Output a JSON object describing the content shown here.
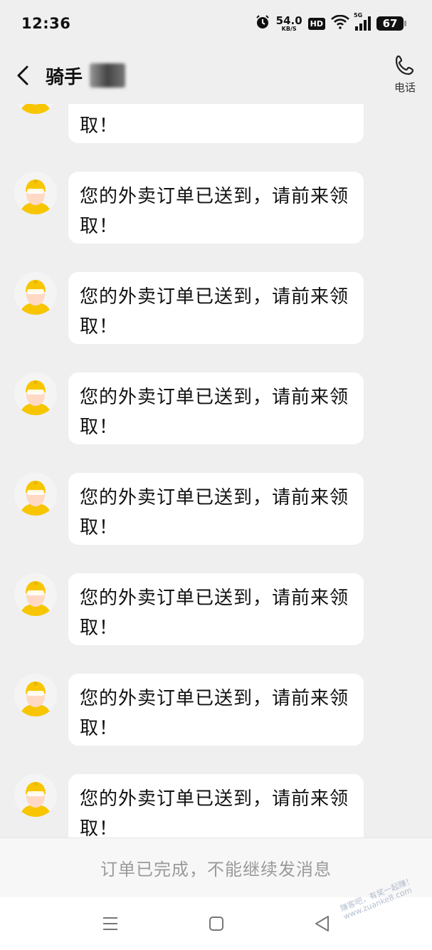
{
  "status_bar": {
    "time": "12:36",
    "net_speed": "54.0",
    "net_unit": "KB/S",
    "hd": "HD",
    "network": "5G",
    "battery": "67"
  },
  "header": {
    "title": "骑手",
    "call_label": "电话"
  },
  "messages": [
    {
      "text": "您的外卖订单已送到，请前来领取！"
    },
    {
      "text": "您的外卖订单已送到，请前来领取！"
    },
    {
      "text": "您的外卖订单已送到，请前来领取！"
    },
    {
      "text": "您的外卖订单已送到，请前来领取！"
    },
    {
      "text": "您的外卖订单已送到，请前来领取！"
    },
    {
      "text": "您的外卖订单已送到，请前来领取！"
    },
    {
      "text": "您的外卖订单已送到，请前来领取！"
    },
    {
      "text": "您的外卖订单已送到，请前来领取！"
    }
  ],
  "notice": "订单已完成，不能继续发消息",
  "watermark": {
    "line1": "赚客吧，有奖一起赚！",
    "line2": "www.zuanke8.com"
  },
  "colors": {
    "background": "#efefef",
    "bubble": "#ffffff",
    "avatar_yellow": "#f7c600",
    "notice_text": "#9a9a9a"
  }
}
